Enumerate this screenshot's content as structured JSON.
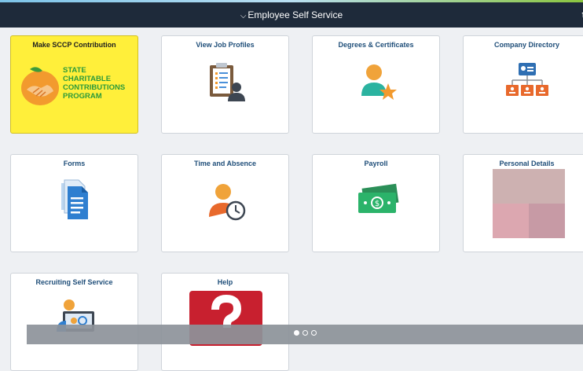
{
  "header": {
    "title": "Employee Self Service",
    "edge_glyph": "t"
  },
  "tiles": [
    {
      "id": "sccp",
      "label": "Make SCCP Contribution",
      "logo_lines": [
        "STATE",
        "CHARITABLE",
        "CONTRIBUTIONS",
        "PROGRAM"
      ]
    },
    {
      "id": "job-profiles",
      "label": "View Job Profiles"
    },
    {
      "id": "degrees",
      "label": "Degrees & Certificates"
    },
    {
      "id": "directory",
      "label": "Company Directory"
    },
    {
      "id": "forms",
      "label": "Forms"
    },
    {
      "id": "time",
      "label": "Time and Absence"
    },
    {
      "id": "payroll",
      "label": "Payroll"
    },
    {
      "id": "personal",
      "label": "Personal Details"
    },
    {
      "id": "recruiting",
      "label": "Recruiting Self Service"
    },
    {
      "id": "help",
      "label": "Help"
    }
  ],
  "icons": {
    "sccp": "orange-handshake-icon",
    "job-profiles": "clipboard-person-icon",
    "degrees": "person-star-icon",
    "directory": "org-chart-icon",
    "forms": "documents-icon",
    "time": "person-clock-icon",
    "payroll": "money-bills-icon",
    "personal": "color-blocks-image",
    "recruiting": "monitor-person-icon",
    "help": "question-mark-icon"
  },
  "pager": {
    "pages": 3,
    "active": 1
  },
  "colors": {
    "header_bg": "#1e2a3a",
    "tile_title": "#1f4e79",
    "sccp_bg": "#ffef3a",
    "accent_orange": "#f29a2e",
    "accent_teal": "#2bb3a0"
  }
}
